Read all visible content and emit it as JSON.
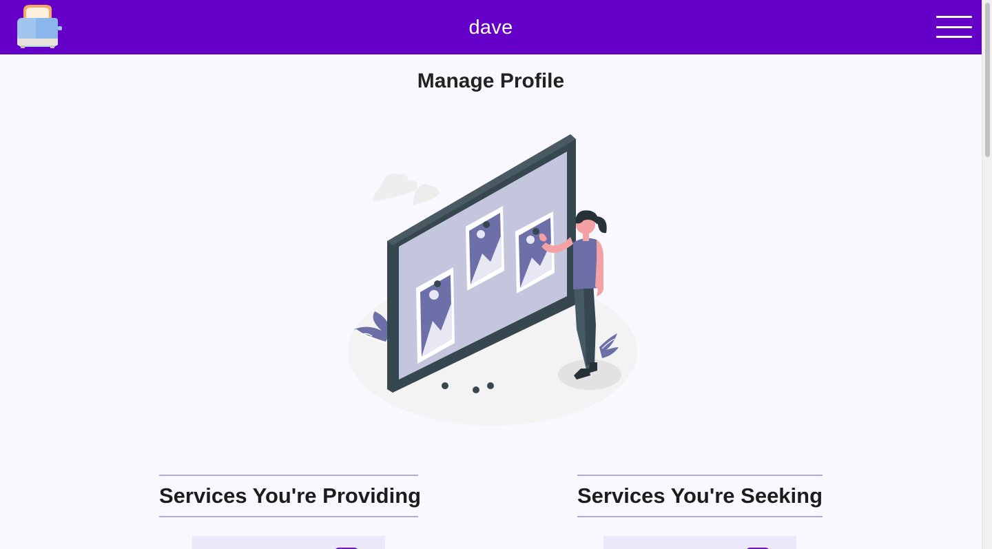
{
  "header": {
    "user_name": "dave",
    "logo_icon": "toaster-icon",
    "menu_icon": "hamburger-menu-icon",
    "background_color": "#6400c8"
  },
  "main": {
    "title": "Manage Profile",
    "illustration_icon": "pinboard-woman-illustration"
  },
  "sections": {
    "providing": {
      "heading": "Services You're Providing"
    },
    "seeking": {
      "heading": "Services You're Seeking"
    }
  },
  "colors": {
    "accent": "#6400c8",
    "divider": "#aab0e6",
    "card_background": "#ebe9f9"
  }
}
